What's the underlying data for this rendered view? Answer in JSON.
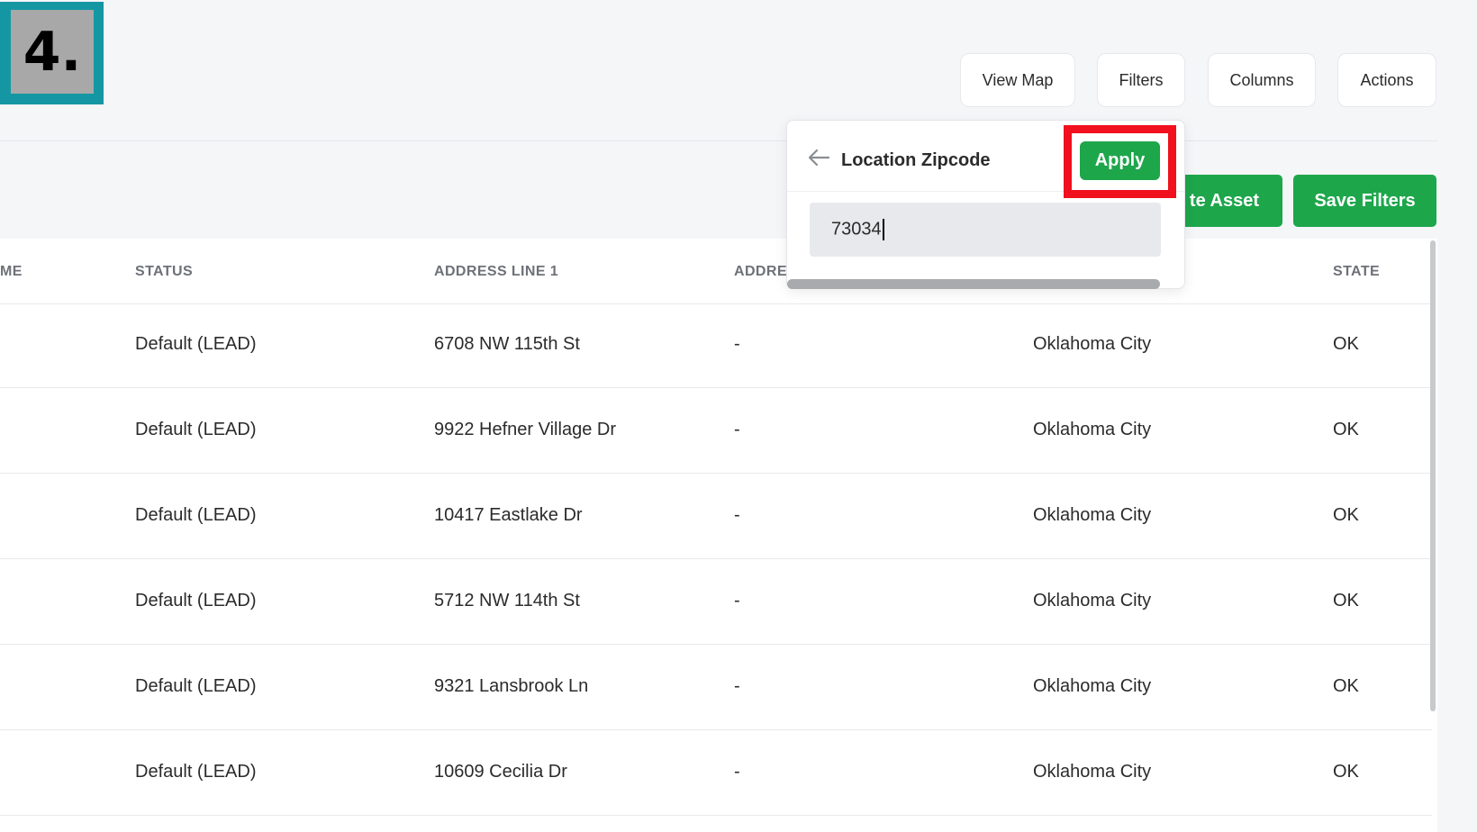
{
  "step_badge": {
    "label": "4."
  },
  "top_toolbar": {
    "view_map": "View Map",
    "filters": "Filters",
    "columns": "Columns",
    "actions": "Actions"
  },
  "action_buttons": {
    "create_asset_partial": "te Asset",
    "save_filters": "Save Filters"
  },
  "filter_popup": {
    "title": "Location Zipcode",
    "apply": "Apply",
    "zipcode_value": "73034"
  },
  "table": {
    "headers": {
      "name_partial": "ME",
      "status": "STATUS",
      "address_line_1": "ADDRESS LINE 1",
      "address_line_2_partial": "ADDRE",
      "state": "STATE"
    },
    "rows": [
      {
        "status": "Default (LEAD)",
        "address1": "6708 NW 115th St",
        "address2": "-",
        "city": "Oklahoma City",
        "state": "OK"
      },
      {
        "status": "Default (LEAD)",
        "address1": "9922 Hefner Village Dr",
        "address2": "-",
        "city": "Oklahoma City",
        "state": "OK"
      },
      {
        "status": "Default (LEAD)",
        "address1": "10417 Eastlake Dr",
        "address2": "-",
        "city": "Oklahoma City",
        "state": "OK"
      },
      {
        "status": "Default (LEAD)",
        "address1": "5712 NW 114th St",
        "address2": "-",
        "city": "Oklahoma City",
        "state": "OK"
      },
      {
        "status": "Default (LEAD)",
        "address1": "9321 Lansbrook Ln",
        "address2": "-",
        "city": "Oklahoma City",
        "state": "OK"
      },
      {
        "status": "Default (LEAD)",
        "address1": "10609 Cecilia Dr",
        "address2": "-",
        "city": "Oklahoma City",
        "state": "OK"
      }
    ]
  },
  "colors": {
    "accent_green": "#1ea64b",
    "highlight_red": "#f0101e",
    "badge_teal": "#1597a3"
  }
}
